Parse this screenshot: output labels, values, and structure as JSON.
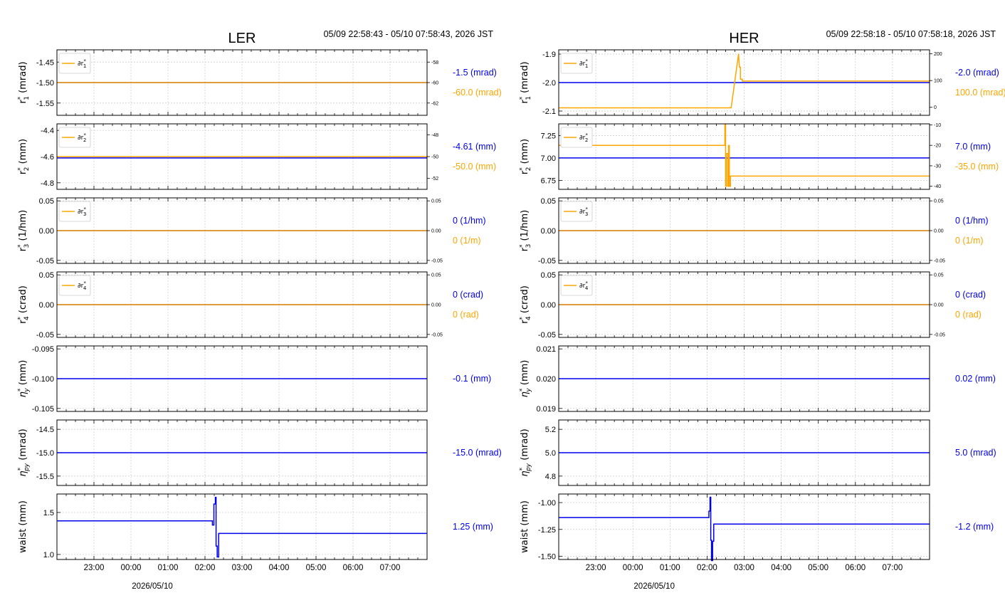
{
  "colors": {
    "primary": "#0000ee",
    "secondary": "#ffa500"
  },
  "chart_data": [
    {
      "type": "line",
      "title": "LER",
      "time_range": "05/09 22:58:43 - 05/10 07:58:43, 2026 JST",
      "date_label": "2026/05/10",
      "xlim": [
        -1.0,
        9.0
      ],
      "x_ticks": [
        {
          "v": 0.0,
          "label": "23:00"
        },
        {
          "v": 1.0,
          "label": "00:00"
        },
        {
          "v": 2.0,
          "label": "01:00"
        },
        {
          "v": 3.0,
          "label": "02:00"
        },
        {
          "v": 4.0,
          "label": "03:00"
        },
        {
          "v": 5.0,
          "label": "04:00"
        },
        {
          "v": 6.0,
          "label": "05:00"
        },
        {
          "v": 7.0,
          "label": "06:00"
        },
        {
          "v": 8.0,
          "label": "07:00"
        }
      ],
      "panels": [
        {
          "ylabel": "r₁* (mrad)",
          "ylim": [
            -1.58,
            -1.42
          ],
          "yticks": [
            "-1.45",
            "-1.50",
            "-1.55"
          ],
          "ytick_vals": [
            -1.45,
            -1.5,
            -1.55
          ],
          "series": {
            "x": [
              -1,
              9
            ],
            "y": [
              -1.5,
              -1.5
            ]
          },
          "legend": "∂r₁*",
          "right": {
            "ylim": [
              -63.2,
              -56.8
            ],
            "yticks": [
              "-58",
              "-60",
              "-62"
            ],
            "ytick_vals": [
              -58,
              -60,
              -62
            ],
            "series": {
              "x": [
                -1,
                9
              ],
              "y": [
                -60,
                -60
              ]
            }
          },
          "ann": "-1.5 (mrad)",
          "ann2": "-60.0 (mrad)"
        },
        {
          "ylabel": "r₂* (mm)",
          "ylim": [
            -4.85,
            -4.35
          ],
          "yticks": [
            "-4.4",
            "-4.6",
            "-4.8"
          ],
          "ytick_vals": [
            -4.4,
            -4.6,
            -4.8
          ],
          "series": {
            "x": [
              -1,
              9
            ],
            "y": [
              -4.61,
              -4.61
            ]
          },
          "legend": "∂r₂*",
          "right": {
            "ylim": [
              -53.0,
              -47.0
            ],
            "yticks": [
              "-48",
              "-50",
              "-52"
            ],
            "ytick_vals": [
              -48,
              -50,
              -52
            ],
            "series": {
              "x": [
                -1,
                9
              ],
              "y": [
                -50,
                -50
              ]
            }
          },
          "ann": "-4.61 (mm)",
          "ann2": "-50.0 (mm)"
        },
        {
          "ylabel": "r₃* (1/hm)",
          "ylim": [
            -0.055,
            0.055
          ],
          "yticks": [
            "0.05",
            "0.00",
            "-0.05"
          ],
          "ytick_vals": [
            0.05,
            0,
            -0.05
          ],
          "series": {
            "x": [
              -1,
              9
            ],
            "y": [
              0,
              0
            ]
          },
          "legend": "∂r₃*",
          "right": {
            "ylim": [
              -0.055,
              0.055
            ],
            "yticks": [
              "0.05",
              "0.00",
              "-0.05"
            ],
            "ytick_vals": [
              0.05,
              0,
              -0.05
            ],
            "series": {
              "x": [
                -1,
                9
              ],
              "y": [
                0,
                0
              ]
            }
          },
          "ann": "0 (1/hm)",
          "ann2": "0 (1/m)"
        },
        {
          "ylabel": "r₄* (crad)",
          "ylim": [
            -0.055,
            0.055
          ],
          "yticks": [
            "0.05",
            "0.00",
            "-0.05"
          ],
          "ytick_vals": [
            0.05,
            0,
            -0.05
          ],
          "series": {
            "x": [
              -1,
              9
            ],
            "y": [
              0,
              0
            ]
          },
          "legend": "∂r₄*",
          "right": {
            "ylim": [
              -0.055,
              0.055
            ],
            "yticks": [
              "0.05",
              "0.00",
              "-0.05"
            ],
            "ytick_vals": [
              0.05,
              0,
              -0.05
            ],
            "series": {
              "x": [
                -1,
                9
              ],
              "y": [
                0,
                0
              ]
            }
          },
          "ann": "0 (crad)",
          "ann2": "0 (rad)"
        },
        {
          "ylabel": "ηy* (mm)",
          "ylim": [
            -0.1055,
            -0.0945
          ],
          "yticks": [
            "-0.095",
            "-0.100",
            "-0.105"
          ],
          "ytick_vals": [
            -0.095,
            -0.1,
            -0.105
          ],
          "series": {
            "x": [
              -1,
              9
            ],
            "y": [
              -0.1,
              -0.1
            ]
          },
          "ann": "-0.1 (mm)"
        },
        {
          "ylabel": "ηpy* (mrad)",
          "ylim": [
            -15.7,
            -14.3
          ],
          "yticks": [
            "-14.5",
            "-15.0",
            "-15.5"
          ],
          "ytick_vals": [
            -14.5,
            -15.0,
            -15.5
          ],
          "series": {
            "x": [
              -1,
              9
            ],
            "y": [
              -15.0,
              -15.0
            ]
          },
          "ann": "-15.0 (mrad)"
        },
        {
          "ylabel": "waist (mm)",
          "ylim": [
            0.94,
            1.72
          ],
          "yticks": [
            "1.5",
            "1.0"
          ],
          "ytick_vals": [
            1.5,
            1.0
          ],
          "series": {
            "x": [
              -1,
              3.2,
              3.2,
              3.24,
              3.24,
              3.28,
              3.28,
              3.3,
              3.3,
              3.33,
              3.33,
              3.37,
              3.37,
              9
            ],
            "y": [
              1.4,
              1.4,
              1.35,
              1.35,
              1.6,
              1.6,
              1.68,
              1.68,
              1.1,
              1.1,
              0.97,
              0.97,
              1.25,
              1.25
            ]
          },
          "ann": "1.25 (mm)"
        }
      ]
    },
    {
      "type": "line",
      "title": "HER",
      "time_range": "05/09 22:58:18 - 05/10 07:58:18, 2026 JST",
      "date_label": "2026/05/10",
      "xlim": [
        -1.0,
        9.0
      ],
      "x_ticks": [
        {
          "v": 0.0,
          "label": "23:00"
        },
        {
          "v": 1.0,
          "label": "00:00"
        },
        {
          "v": 2.0,
          "label": "01:00"
        },
        {
          "v": 3.0,
          "label": "02:00"
        },
        {
          "v": 4.0,
          "label": "03:00"
        },
        {
          "v": 5.0,
          "label": "04:00"
        },
        {
          "v": 6.0,
          "label": "05:00"
        },
        {
          "v": 7.0,
          "label": "06:00"
        },
        {
          "v": 8.0,
          "label": "07:00"
        }
      ],
      "panels": [
        {
          "ylabel": "r₁* (mrad)",
          "ylim": [
            -2.115,
            -1.885
          ],
          "yticks": [
            "-1.9",
            "-2.0",
            "-2.1"
          ],
          "ytick_vals": [
            -1.9,
            -2.0,
            -2.1
          ],
          "series": {
            "x": [
              -1,
              9
            ],
            "y": [
              -2.0,
              -2.0
            ]
          },
          "legend": "∂r₁*",
          "right": {
            "ylim": [
              -30,
              215
            ],
            "yticks": [
              "200",
              "100",
              "0"
            ],
            "ytick_vals": [
              200,
              100,
              0
            ],
            "series": {
              "x": [
                -1,
                3.65,
                3.85,
                3.87,
                3.9,
                3.9,
                3.95,
                3.95,
                9
              ],
              "y": [
                -2,
                -2,
                200,
                150,
                150,
                105,
                105,
                98,
                98
              ]
            }
          },
          "ann": "-2.0 (mrad)",
          "ann2": "100.0 (mrad)"
        },
        {
          "ylabel": "r₂* (mm)",
          "ylim": [
            6.65,
            7.38
          ],
          "yticks": [
            "7.25",
            "7.00",
            "6.75"
          ],
          "ytick_vals": [
            7.25,
            7.0,
            6.75
          ],
          "series": {
            "x": [
              -1,
              9
            ],
            "y": [
              7.0,
              7.0
            ]
          },
          "legend": "∂r₂*",
          "right": {
            "ylim": [
              -41.5,
              -9.5
            ],
            "yticks": [
              "-10",
              "-20",
              "-30",
              "-40"
            ],
            "ytick_vals": [
              -10,
              -20,
              -30,
              -40
            ],
            "series": {
              "x": [
                -1,
                3.48,
                3.48,
                3.5,
                3.5,
                3.52,
                3.52,
                3.56,
                3.56,
                3.58,
                3.58,
                3.6,
                3.6,
                3.63,
                3.63,
                9
              ],
              "y": [
                -20,
                -20,
                -10,
                -10,
                -40,
                -40,
                -24,
                -24,
                -40,
                -40,
                -20,
                -20,
                -40,
                -40,
                -35,
                -35
              ]
            }
          },
          "ann": "7.0 (mm)",
          "ann2": "-35.0 (mm)"
        },
        {
          "ylabel": "r₃* (1/hm)",
          "ylim": [
            -0.055,
            0.055
          ],
          "yticks": [
            "0.05",
            "0.00",
            "-0.05"
          ],
          "ytick_vals": [
            0.05,
            0,
            -0.05
          ],
          "series": {
            "x": [
              -1,
              9
            ],
            "y": [
              0,
              0
            ]
          },
          "legend": "∂r₃*",
          "right": {
            "ylim": [
              -0.055,
              0.055
            ],
            "yticks": [
              "0.05",
              "0.00",
              "-0.05"
            ],
            "ytick_vals": [
              0.05,
              0,
              -0.05
            ],
            "series": {
              "x": [
                -1,
                9
              ],
              "y": [
                0,
                0
              ]
            }
          },
          "ann": "0 (1/hm)",
          "ann2": "0 (1/m)"
        },
        {
          "ylabel": "r₄* (crad)",
          "ylim": [
            -0.055,
            0.055
          ],
          "yticks": [
            "0.05",
            "0.00",
            "-0.05"
          ],
          "ytick_vals": [
            0.05,
            0,
            -0.05
          ],
          "series": {
            "x": [
              -1,
              9
            ],
            "y": [
              0,
              0
            ]
          },
          "legend": "∂r₄*",
          "right": {
            "ylim": [
              -0.055,
              0.055
            ],
            "yticks": [
              "0.05",
              "0.00",
              "-0.05"
            ],
            "ytick_vals": [
              0.05,
              0,
              -0.05
            ],
            "series": {
              "x": [
                -1,
                9
              ],
              "y": [
                0,
                0
              ]
            }
          },
          "ann": "0 (crad)",
          "ann2": "0 (rad)"
        },
        {
          "ylabel": "ηy* (mm)",
          "ylim": [
            0.0189,
            0.0211
          ],
          "yticks": [
            "0.021",
            "0.020",
            "0.019"
          ],
          "ytick_vals": [
            0.021,
            0.02,
            0.019
          ],
          "series": {
            "x": [
              -1,
              9
            ],
            "y": [
              0.02,
              0.02
            ]
          },
          "ann": "0.02 (mm)"
        },
        {
          "ylabel": "ηpy* (mrad)",
          "ylim": [
            4.72,
            5.28
          ],
          "yticks": [
            "5.2",
            "5.0",
            "4.8"
          ],
          "ytick_vals": [
            5.2,
            5.0,
            4.8
          ],
          "series": {
            "x": [
              -1,
              9
            ],
            "y": [
              5.0,
              5.0
            ]
          },
          "ann": "5.0 (mrad)"
        },
        {
          "ylabel": "waist (mm)",
          "ylim": [
            -1.53,
            -0.92
          ],
          "yticks": [
            "-1.00",
            "-1.25",
            "-1.50"
          ],
          "ytick_vals": [
            -1.0,
            -1.25,
            -1.5
          ],
          "series": {
            "x": [
              -1,
              3.05,
              3.05,
              3.08,
              3.08,
              3.1,
              3.1,
              3.12,
              3.12,
              3.15,
              3.15,
              3.18,
              3.18,
              9
            ],
            "y": [
              -1.14,
              -1.14,
              -1.08,
              -1.08,
              -0.95,
              -0.95,
              -1.35,
              -1.35,
              -1.54,
              -1.54,
              -1.36,
              -1.36,
              -1.2,
              -1.2
            ]
          },
          "ann": "-1.2 (mm)"
        }
      ]
    }
  ]
}
